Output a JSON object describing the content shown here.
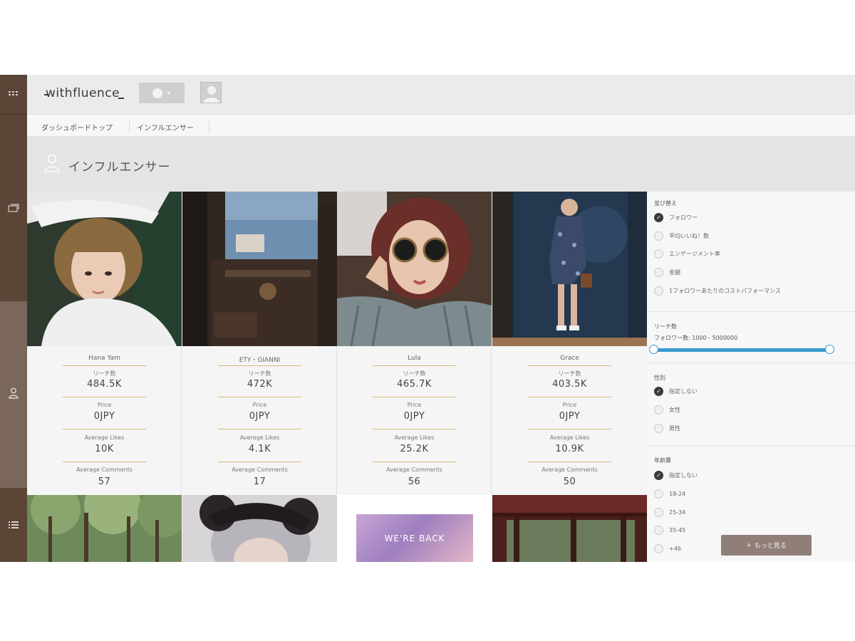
{
  "header": {
    "logo": "withfluence"
  },
  "breadcrumb": {
    "items": [
      "ダッシュボードトップ",
      "インフルエンサー"
    ]
  },
  "page": {
    "title": "インフルエンサー"
  },
  "cards": [
    {
      "name": "Hana Yam",
      "reach_label": "リーチ数",
      "reach": "484.5K",
      "price_label": "Price",
      "price": "0JPY",
      "likes_label": "Average Likes",
      "likes": "10K",
      "comments_label": "Average Comments",
      "comments": "57"
    },
    {
      "name": "ETY・GIANNI",
      "reach_label": "リーチ数",
      "reach": "472K",
      "price_label": "Price",
      "price": "0JPY",
      "likes_label": "Average Likes",
      "likes": "4.1K",
      "comments_label": "Average Comments",
      "comments": "17"
    },
    {
      "name": "Lula",
      "reach_label": "リーチ数",
      "reach": "465.7K",
      "price_label": "Price",
      "price": "0JPY",
      "likes_label": "Average Likes",
      "likes": "25.2K",
      "comments_label": "Average Comments",
      "comments": "56"
    },
    {
      "name": "Grace",
      "reach_label": "リーチ数",
      "reach": "403.5K",
      "price_label": "Price",
      "price": "0JPY",
      "likes_label": "Average Likes",
      "likes": "10.9K",
      "comments_label": "Average Comments",
      "comments": "50"
    }
  ],
  "second_row": {
    "banner_text": "WE'RE BACK"
  },
  "filters": {
    "sort_title": "並び替え",
    "sort_options": [
      "フォロワー",
      "平均いいね！数",
      "エンゲージメント率",
      "金額",
      "1フォロワーあたりのコストパフォーマンス"
    ],
    "reach_title": "リーチ数",
    "reach_range_label": "フォロワー数: 1000 - 5000000",
    "gender_title": "性別",
    "gender_options": [
      "指定しない",
      "女性",
      "男性"
    ],
    "age_title": "年齢層",
    "age_options": [
      "指定しない",
      "18-24",
      "25-34",
      "35-45",
      "+46"
    ],
    "more_button": "もっと見る"
  }
}
